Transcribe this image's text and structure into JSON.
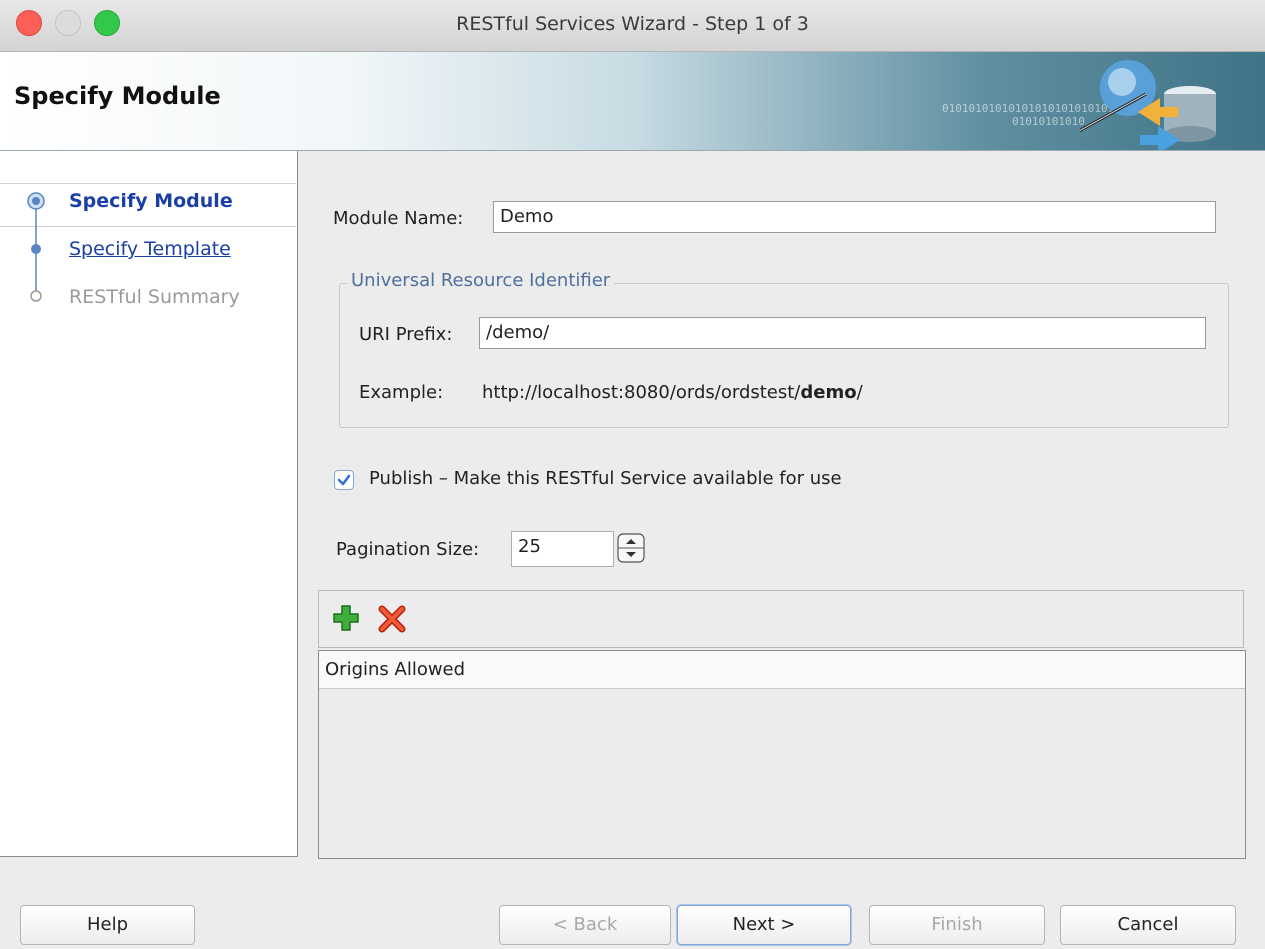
{
  "window": {
    "title": "RESTful Services Wizard - Step 1 of 3",
    "traffic_lights": [
      "close",
      "minimize",
      "zoom"
    ]
  },
  "header": {
    "title": "Specify Module",
    "binary_line_1": "0101010101010101010101010101",
    "binary_line_2": "01010101010"
  },
  "steps": [
    {
      "label": "Specify Module",
      "state": "active"
    },
    {
      "label": "Specify Template",
      "state": "link"
    },
    {
      "label": "RESTful Summary",
      "state": "disabled"
    }
  ],
  "form": {
    "module_name_label": "Module Name:",
    "module_name_value": "Demo",
    "uri_group_title": "Universal Resource Identifier",
    "uri_prefix_label": "URI Prefix:",
    "uri_prefix_value": "/demo/",
    "example_label": "Example:",
    "example_url_base": "http://localhost:8080/ords/ordstest/",
    "example_url_bold": "demo",
    "example_url_suffix": "/",
    "publish_label": "Publish – Make this RESTful Service available for use",
    "publish_checked": true,
    "pagination_label": "Pagination Size:",
    "pagination_value": "25"
  },
  "origins": {
    "column_header": "Origins Allowed",
    "rows": []
  },
  "buttons": {
    "help": "Help",
    "back": "< Back",
    "next": "Next >",
    "finish": "Finish",
    "cancel": "Cancel"
  },
  "colors": {
    "link_blue": "#1a3fa6",
    "disabled_gray": "#9a9a9a",
    "group_title": "#4f6f9f"
  }
}
